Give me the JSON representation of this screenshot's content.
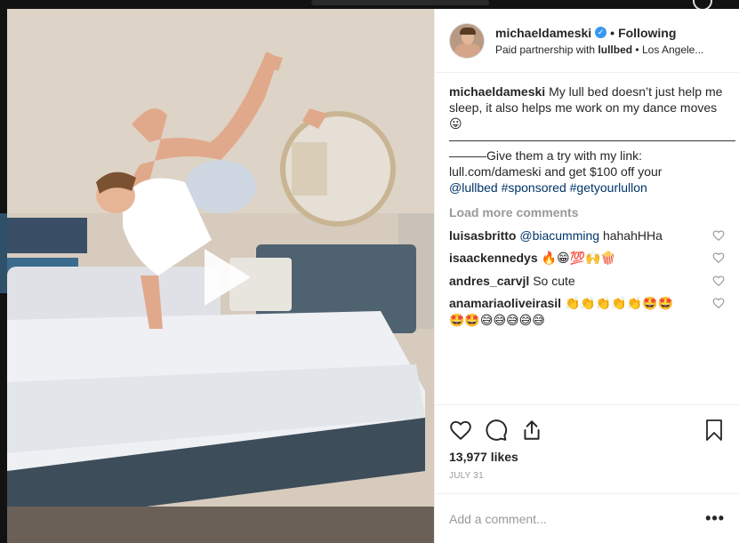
{
  "post": {
    "username": "michaeldameski",
    "verified": true,
    "follow_status": "Following",
    "partnership_prefix": "Paid partnership with",
    "partner": "lullbed",
    "location": "Los Angele...",
    "caption": {
      "user": "michaeldameski",
      "text1": "My lull bed doesn’t just help me sleep, it also helps me work on my dance moves 😛",
      "separator": "———————————————————————",
      "text2": "———Give them a try with my link: lull.com/dameski and get $100 off your",
      "mention": "@lullbed",
      "hashtag1": "#sponsored",
      "hashtag2": "#getyourlullon"
    },
    "load_more": "Load more comments",
    "comments": [
      {
        "user": "luisasbritto",
        "mention": "@biacumming",
        "text": "hahahHHa"
      },
      {
        "user": "isaackennedys",
        "mention": "",
        "text": "🔥😁💯🙌🍿"
      },
      {
        "user": "andres_carvjl",
        "mention": "",
        "text": "So cute"
      },
      {
        "user": "anamariaoliveirasil",
        "mention": "",
        "text": "👏👏👏👏👏🤩🤩🤩🤩😅😅😅😅😅"
      }
    ],
    "likes": "13,977 likes",
    "date": "JULY 31",
    "add_comment_placeholder": "Add a comment...",
    "more_options": "•••"
  },
  "colors": {
    "link": "#003569",
    "verified": "#3897f0",
    "muted": "#999999"
  },
  "icons": [
    "play-icon",
    "heart-icon",
    "comment-icon",
    "share-icon",
    "bookmark-icon",
    "verified-badge-icon",
    "more-icon"
  ]
}
